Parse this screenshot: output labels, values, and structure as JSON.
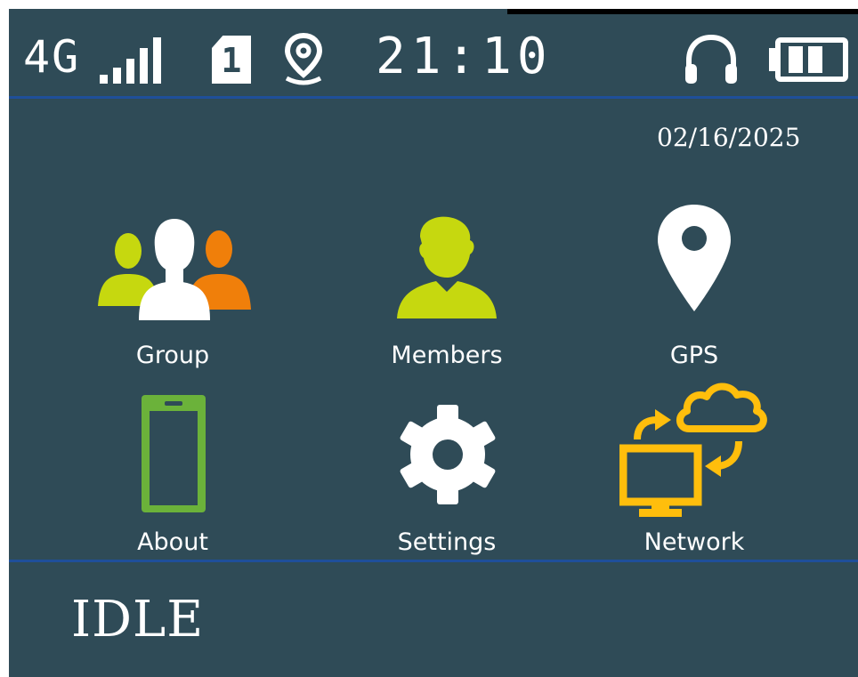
{
  "status_bar": {
    "network_type": "4G",
    "signal_icon": "signal-bars-icon",
    "sim_slot": "1",
    "location_icon": "location-pin-icon",
    "time": "21:10",
    "headset_icon": "headphones-icon",
    "battery_icon": "battery-icon"
  },
  "date": "02/16/2025",
  "menu": [
    {
      "label": "Group",
      "icon": "group-icon"
    },
    {
      "label": "Members",
      "icon": "member-icon"
    },
    {
      "label": "GPS",
      "icon": "map-pin-icon"
    },
    {
      "label": "About",
      "icon": "phone-icon"
    },
    {
      "label": "Settings",
      "icon": "gear-icon"
    },
    {
      "label": "Network",
      "icon": "network-cloud-icon"
    }
  ],
  "status_text": "IDLE",
  "colors": {
    "background": "#2f4b57",
    "divider": "#1f4f9a",
    "lime": "#c6d80f",
    "orange": "#f07f0a",
    "green": "#6bb23a",
    "yellow": "#ffbe0c"
  }
}
